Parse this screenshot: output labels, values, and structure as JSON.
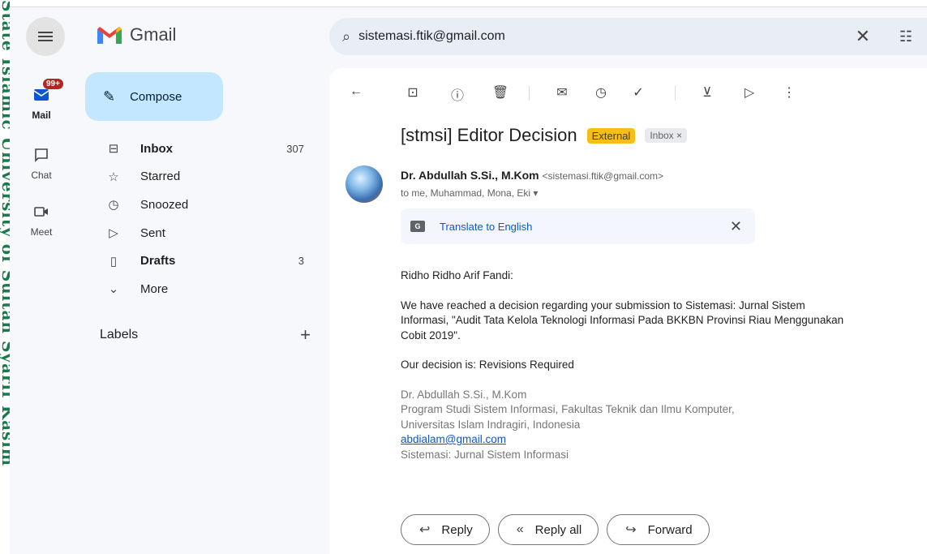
{
  "app": {
    "name": "Gmail"
  },
  "watermark": {
    "text": "State Islamic University of Sultan Syarif Kasim"
  },
  "rail": {
    "items": [
      {
        "label": "Mail",
        "icon": "mail-icon",
        "badge": "99+"
      },
      {
        "label": "Chat",
        "icon": "chat-icon"
      },
      {
        "label": "Meet",
        "icon": "video-icon"
      }
    ]
  },
  "sidebar": {
    "compose_label": "Compose",
    "items": [
      {
        "label": "Inbox",
        "icon": "inbox-icon",
        "count": "307",
        "bold": true
      },
      {
        "label": "Starred",
        "icon": "star-icon",
        "count": ""
      },
      {
        "label": "Snoozed",
        "icon": "clock-icon",
        "count": ""
      },
      {
        "label": "Sent",
        "icon": "send-icon",
        "count": ""
      },
      {
        "label": "Drafts",
        "icon": "draft-icon",
        "count": "3",
        "bold": true
      },
      {
        "label": "More",
        "icon": "chevron-down-icon",
        "count": ""
      }
    ],
    "labels_heading": "Labels"
  },
  "search": {
    "value": "sistemasi.ftik@gmail.com"
  },
  "toolbar": {
    "icons": [
      "back-icon",
      "archive-icon",
      "report-spam-icon",
      "delete-icon",
      "mark-unread-icon",
      "snooze-icon",
      "add-task-icon",
      "move-to-icon",
      "label-icon",
      "more-icon"
    ]
  },
  "email": {
    "subject": "[stmsi] Editor Decision",
    "tag_external": "External",
    "tag_inbox": "Inbox ×",
    "sender_name": "Dr. Abdullah S.Si., M.Kom",
    "sender_email": "<sistemasi.ftik@gmail.com>",
    "recipients": "to me, Muhammad, Mona, Eki ▾",
    "translate_label": "Translate to English",
    "greeting": "Ridho Ridho Arif Fandi:",
    "para1": "We have reached a decision regarding your submission to Sistemasi: Jurnal Sistem Informasi, \"Audit Tata Kelola Teknologi Informasi Pada BKKBN Provinsi Riau Menggunakan Cobit 2019\".",
    "para2": "Our decision is: Revisions Required",
    "sig_name": "Dr. Abdullah S.Si., M.Kom",
    "sig_line1": "Program Studi Sistem Informasi, Fakultas Teknik dan Ilmu Komputer,",
    "sig_line2": "Universitas Islam Indragiri, Indonesia",
    "sig_email": "abdialam@gmail.com",
    "sig_journal": "Sistemasi: Jurnal Sistem Informasi"
  },
  "actions": {
    "reply": "Reply",
    "reply_all": "Reply all",
    "forward": "Forward"
  }
}
